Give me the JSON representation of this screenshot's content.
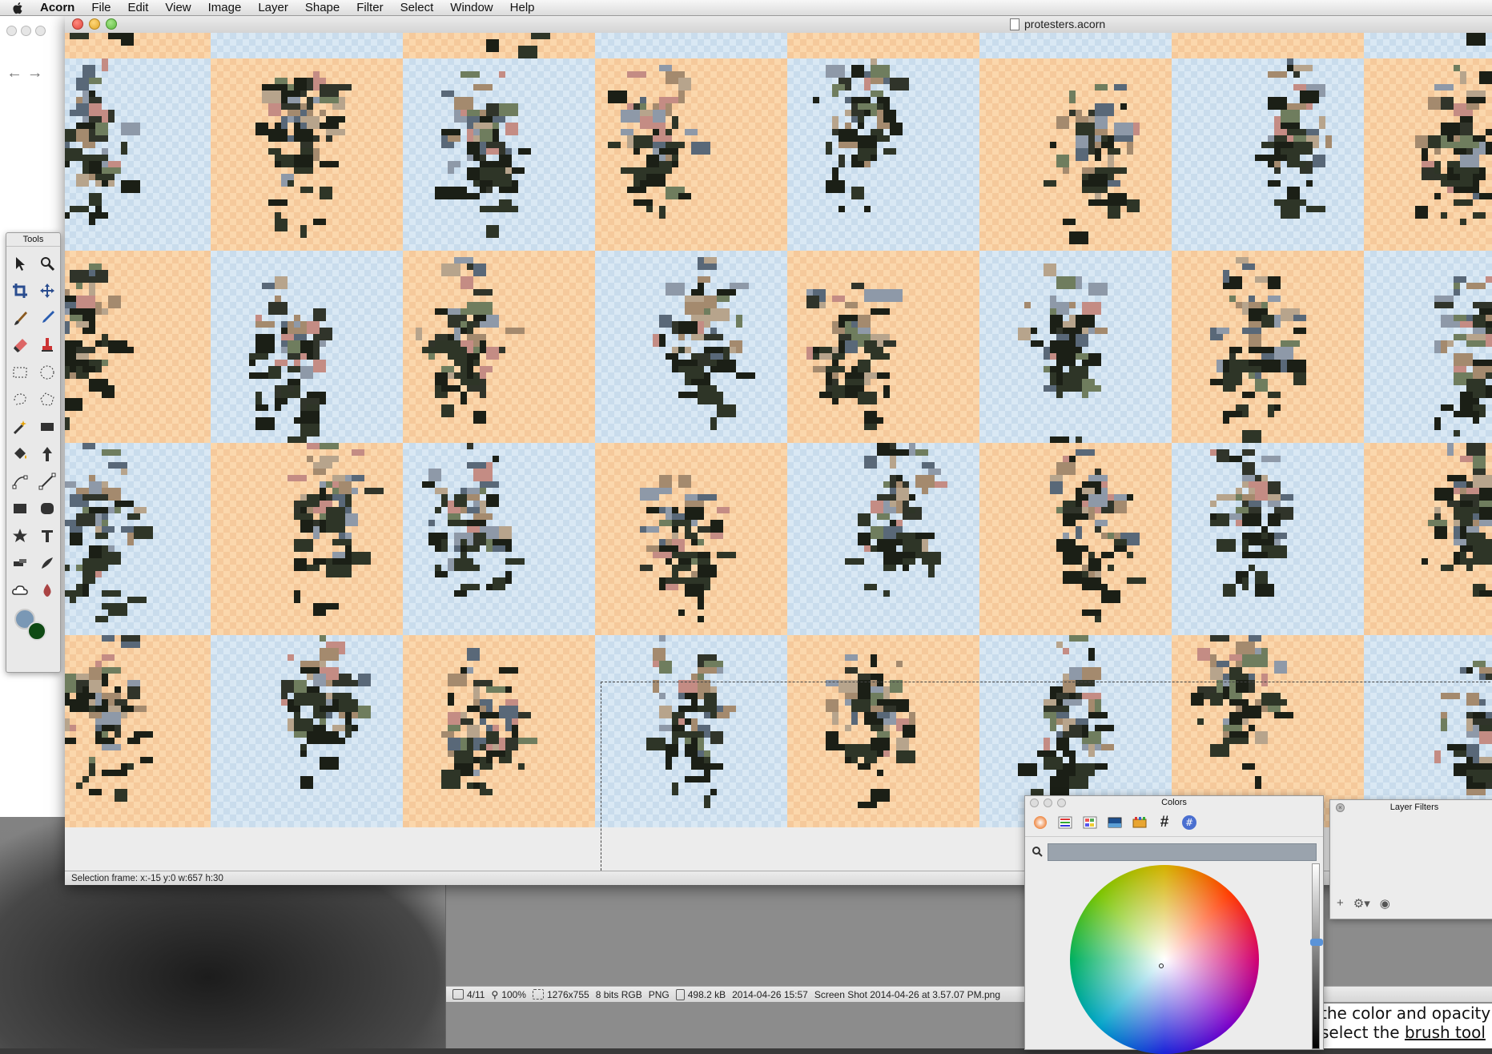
{
  "menubar": {
    "app": "Acorn",
    "items": [
      "File",
      "Edit",
      "View",
      "Image",
      "Layer",
      "Shape",
      "Filter",
      "Select",
      "Window",
      "Help"
    ]
  },
  "window": {
    "title": "protesters.acorn",
    "status": "Selection frame: x:-15 y:0 w:657 h:30"
  },
  "tools": {
    "title": "Tools",
    "icons": [
      "select-arrow-icon",
      "zoom-icon",
      "crop-icon",
      "move-icon",
      "brush-icon",
      "pencil-icon",
      "eraser-icon",
      "clone-stamp-icon",
      "rect-select-icon",
      "ellipse-select-icon",
      "lasso-icon",
      "polygon-lasso-icon",
      "magic-wand-icon",
      "rectangle-icon",
      "paint-bucket-icon",
      "gradient-icon",
      "bezier-icon",
      "line-icon",
      "rect-shape-icon",
      "rounded-rect-icon",
      "star-icon",
      "text-icon",
      "smudge-icon",
      "burn-icon",
      "cloud-icon",
      "blur-icon"
    ],
    "fg_color": "#7a98b5",
    "bg_color": "#0f4a14"
  },
  "second_window": {
    "index": "4/11",
    "zoom": "100%",
    "dimensions": "1276x755",
    "depth": "8 bits RGB",
    "format": "PNG",
    "size": "498.2 kB",
    "date": "2014-04-26 15:57",
    "filename": "Screen Shot 2014-04-26 at 3.57.07 PM.png"
  },
  "colors_panel": {
    "title": "Colors",
    "modes": [
      "color-wheel-icon",
      "sliders-icon",
      "palettes-icon",
      "image-palette-icon",
      "crayons-icon",
      "hex-icon",
      "hex-circle-icon"
    ]
  },
  "layer_filters": {
    "title": "Layer Filters"
  },
  "text_doc": {
    "line1": "the color and opacity",
    "line2_pre": "select the ",
    "line2_link": "brush tool"
  },
  "canvas": {
    "tile_colors": {
      "orange": "#fbd7ac",
      "blue": "#d9e8f4"
    }
  }
}
